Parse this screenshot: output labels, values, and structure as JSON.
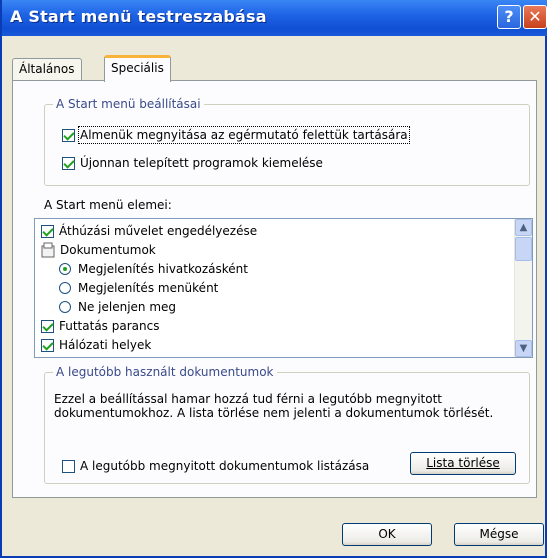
{
  "window": {
    "title": "A Start menü testreszabása",
    "help_glyph": "?",
    "close_glyph": "✕"
  },
  "tabs": [
    {
      "label": "Általános",
      "selected": false
    },
    {
      "label": "Speciális",
      "selected": true
    }
  ],
  "settings_group": {
    "legend": "A Start menü beállításai",
    "options": [
      {
        "label": "Almenük megnyitása az egérmutató felettük tartására",
        "checked": true
      },
      {
        "label": "Újonnan telepített programok kiemelése",
        "checked": true
      }
    ]
  },
  "menu_items": {
    "label": "A Start menü elemei:",
    "items": [
      {
        "label": "Áthúzási művelet engedélyezése",
        "kind": "checkbox",
        "checked": true
      },
      {
        "label": "Dokumentumok",
        "kind": "folder-icon"
      },
      {
        "label": "Megjelenítés hivatkozásként",
        "kind": "radio",
        "selected": true
      },
      {
        "label": "Megjelenítés menüként",
        "kind": "radio",
        "selected": false
      },
      {
        "label": "Ne jelenjen meg",
        "kind": "radio",
        "selected": false
      },
      {
        "label": "Futtatás parancs",
        "kind": "checkbox",
        "checked": true
      },
      {
        "label": "Hálózati helyek",
        "kind": "checkbox",
        "checked": true
      }
    ]
  },
  "recent_group": {
    "legend": "A legutóbb használt dokumentumok",
    "description": "Ezzel a beállítással hamar hozzá tud férni a legutóbb megnyitott dokumentumokhoz. A lista törlése nem jelenti a dokumentumok törlését.",
    "checkbox_label": "A legutóbb megnyitott dokumentumok listázása",
    "checkbox_checked": false,
    "clear_button": "Lista törlése"
  },
  "footer": {
    "ok_label": "OK",
    "cancel_label": "Mégse"
  }
}
